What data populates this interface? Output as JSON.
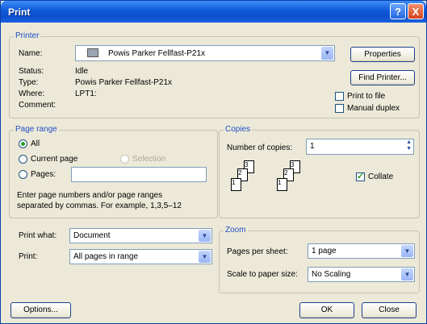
{
  "window": {
    "title": "Print",
    "help_glyph": "?",
    "close_glyph": "X"
  },
  "printer": {
    "group_label": "Printer",
    "name_label": "Name:",
    "name_value": "Powis Parker Fellfast-P21x",
    "properties_button": "Properties",
    "status_label": "Status:",
    "status_value": "Idle",
    "type_label": "Type:",
    "type_value": "Powis Parker Fellfast-P21x",
    "where_label": "Where:",
    "where_value": "LPT1:",
    "comment_label": "Comment:",
    "find_printer_button": "Find Printer...",
    "print_to_file_label": "Print to file",
    "manual_duplex_label": "Manual duplex"
  },
  "page_range": {
    "group_label": "Page range",
    "all_label": "All",
    "current_page_label": "Current page",
    "selection_label": "Selection",
    "pages_label": "Pages:",
    "pages_value": "",
    "help_text_line1": "Enter page numbers and/or page ranges",
    "help_text_line2": "separated by commas.  For example, 1,3,5–12"
  },
  "copies": {
    "group_label": "Copies",
    "number_label": "Number of copies:",
    "number_value": "1",
    "collate_label": "Collate",
    "collate_checked": true,
    "collate_icons": [
      [
        "3",
        "2",
        "1"
      ],
      [
        "3",
        "2",
        "1"
      ]
    ]
  },
  "print_what": {
    "label": "Print what:",
    "value": "Document"
  },
  "print_range": {
    "label": "Print:",
    "value": "All pages in range"
  },
  "zoom": {
    "group_label": "Zoom",
    "pages_per_sheet_label": "Pages per sheet:",
    "pages_per_sheet_value": "1 page",
    "scale_label": "Scale to paper size:",
    "scale_value": "No Scaling"
  },
  "buttons": {
    "options": "Options...",
    "ok": "OK",
    "close": "Close"
  }
}
